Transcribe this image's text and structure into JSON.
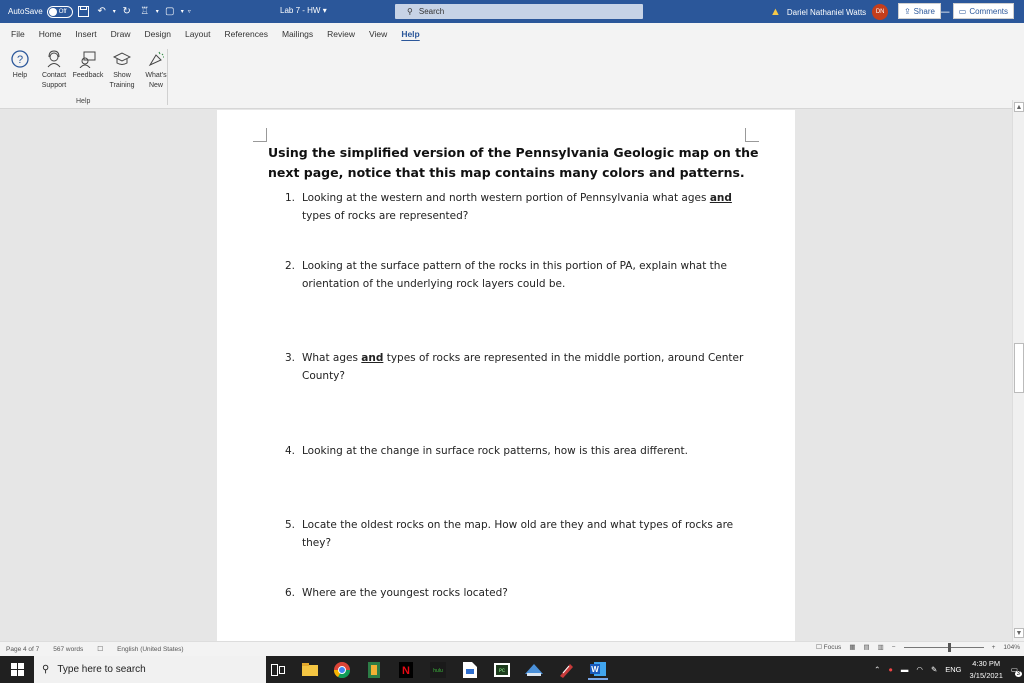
{
  "titlebar": {
    "autosave_label": "AutoSave",
    "autosave_state": "Off",
    "doc_title": "Lab 7 - HW",
    "search_placeholder": "Search",
    "user_name": "Dariel Nathaniel Watts",
    "user_initials": "DN"
  },
  "tabs": [
    {
      "label": "File"
    },
    {
      "label": "Home"
    },
    {
      "label": "Insert"
    },
    {
      "label": "Draw"
    },
    {
      "label": "Design"
    },
    {
      "label": "Layout"
    },
    {
      "label": "References"
    },
    {
      "label": "Mailings"
    },
    {
      "label": "Review"
    },
    {
      "label": "View"
    },
    {
      "label": "Help",
      "active": true
    }
  ],
  "ribbon_actions": {
    "share": "Share",
    "comments": "Comments"
  },
  "ribbon": {
    "buttons": [
      {
        "label_line1": "Help",
        "label_line2": "",
        "icon": "question-icon"
      },
      {
        "label_line1": "Contact",
        "label_line2": "Support",
        "icon": "headset-icon"
      },
      {
        "label_line1": "Feedback",
        "label_line2": "",
        "icon": "feedback-icon"
      },
      {
        "label_line1": "Show",
        "label_line2": "Training",
        "icon": "training-cap-icon"
      },
      {
        "label_line1": "What's",
        "label_line2": "New",
        "icon": "megaphone-icon"
      }
    ],
    "group_label": "Help"
  },
  "document": {
    "heading": "Using the simplified version of the Pennsylvania Geologic map on the next page, notice that this map contains many colors and patterns.",
    "questions": [
      {
        "num": "1.",
        "before": "Looking at the western and north western portion of Pennsylvania what ages ",
        "emph": "and",
        "after": " types of rocks are represented?"
      },
      {
        "num": "2.",
        "before": "Looking at the surface pattern of the rocks in this portion of PA, explain what the orientation of the underlying rock layers could be.",
        "emph": "",
        "after": ""
      },
      {
        "num": "3.",
        "before": "What ages ",
        "emph": "and",
        "after": " types of rocks are represented in the middle portion, around Center County?"
      },
      {
        "num": "4.",
        "before": "Looking at the change in surface rock patterns, how is this area different.",
        "emph": "",
        "after": ""
      },
      {
        "num": "5.",
        "before": "Locate the oldest rocks on the map. How old are they and what types of rocks are they?",
        "emph": "",
        "after": ""
      },
      {
        "num": "6.",
        "before": "Where are the youngest rocks located?",
        "emph": "",
        "after": ""
      }
    ]
  },
  "statusbar": {
    "page": "Page 4 of 7",
    "words": "567 words",
    "language": "English (United States)",
    "focus": "Focus",
    "zoom": "104%"
  },
  "taskbar": {
    "search_placeholder": "Type here to search",
    "language": "ENG",
    "time": "4:30 PM",
    "date": "3/15/2021",
    "notifications": "3"
  },
  "colors": {
    "word_blue": "#2b579a",
    "taskbar": "#202020",
    "avatar": "#c43e1c"
  }
}
